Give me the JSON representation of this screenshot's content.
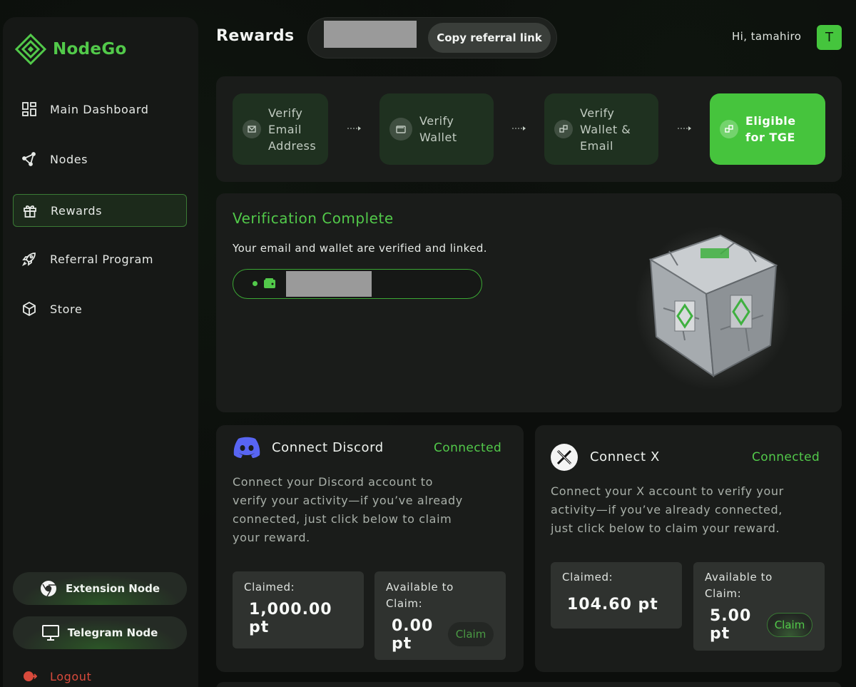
{
  "app": {
    "name": "NodeGo"
  },
  "header": {
    "title": "Rewards",
    "copy_button": "Copy referral link",
    "greeting": "Hi, tamahiro",
    "avatar_initial": "T"
  },
  "sidebar": {
    "items": [
      {
        "label": "Main Dashboard",
        "icon": "grid-icon"
      },
      {
        "label": "Nodes",
        "icon": "nodes-icon"
      },
      {
        "label": "Rewards",
        "icon": "gift-icon",
        "active": true
      },
      {
        "label": "Referral Program",
        "icon": "rocket-icon"
      },
      {
        "label": "Store",
        "icon": "box-icon"
      }
    ],
    "extension_button": "Extension Node",
    "telegram_button": "Telegram Node",
    "logout": "Logout"
  },
  "steps": [
    {
      "label": "Verify Email Address",
      "lines": [
        "Verify",
        "Email",
        "Address"
      ]
    },
    {
      "label": "Verify Wallet",
      "lines": [
        "Verify",
        "Wallet"
      ]
    },
    {
      "label": "Verify Wallet & Email",
      "lines": [
        "Verify",
        "Wallet &",
        "Email"
      ]
    },
    {
      "label": "Eligible for TGE",
      "lines": [
        "Eligible",
        "for TGE"
      ],
      "completed": true
    }
  ],
  "verification": {
    "title": "Verification Complete",
    "description": "Your email and wallet are verified and linked."
  },
  "discord": {
    "title": "Connect Discord",
    "status": "Connected",
    "description": [
      "Connect your Discord account to",
      "verify your activity—if you’ve already",
      "connected, just click below to claim",
      "your reward."
    ],
    "claimed_label": "Claimed:",
    "claimed_value": [
      "1,000.00",
      "pt"
    ],
    "available_label": [
      "Available to",
      "Claim:"
    ],
    "available_value": [
      "0.00",
      "pt"
    ],
    "claim_button": "Claim"
  },
  "x": {
    "title": "Connect X",
    "status": "Connected",
    "description": [
      "Connect your X account to verify your",
      "activity—if you’ve already connected,",
      "just click below to claim your reward."
    ],
    "claimed_label": "Claimed:",
    "claimed_value": "104.60 pt",
    "available_label": [
      "Available to",
      "Claim:"
    ],
    "available_value": [
      "5.00",
      "pt"
    ],
    "claim_button": "Claim"
  },
  "colors": {
    "accent": "#52c94a",
    "danger": "#d84a3c",
    "discord": "#5865f2"
  }
}
